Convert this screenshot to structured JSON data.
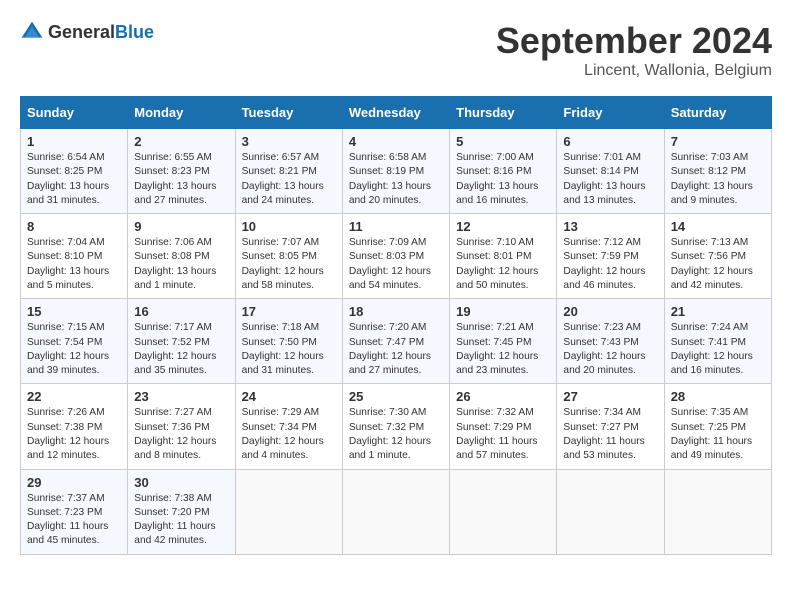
{
  "logo": {
    "general": "General",
    "blue": "Blue"
  },
  "title": "September 2024",
  "location": "Lincent, Wallonia, Belgium",
  "days_of_week": [
    "Sunday",
    "Monday",
    "Tuesday",
    "Wednesday",
    "Thursday",
    "Friday",
    "Saturday"
  ],
  "weeks": [
    [
      {
        "day": "1",
        "sunrise": "6:54 AM",
        "sunset": "8:25 PM",
        "daylight": "13 hours and 31 minutes."
      },
      {
        "day": "2",
        "sunrise": "6:55 AM",
        "sunset": "8:23 PM",
        "daylight": "13 hours and 27 minutes."
      },
      {
        "day": "3",
        "sunrise": "6:57 AM",
        "sunset": "8:21 PM",
        "daylight": "13 hours and 24 minutes."
      },
      {
        "day": "4",
        "sunrise": "6:58 AM",
        "sunset": "8:19 PM",
        "daylight": "13 hours and 20 minutes."
      },
      {
        "day": "5",
        "sunrise": "7:00 AM",
        "sunset": "8:16 PM",
        "daylight": "13 hours and 16 minutes."
      },
      {
        "day": "6",
        "sunrise": "7:01 AM",
        "sunset": "8:14 PM",
        "daylight": "13 hours and 13 minutes."
      },
      {
        "day": "7",
        "sunrise": "7:03 AM",
        "sunset": "8:12 PM",
        "daylight": "13 hours and 9 minutes."
      }
    ],
    [
      {
        "day": "8",
        "sunrise": "7:04 AM",
        "sunset": "8:10 PM",
        "daylight": "13 hours and 5 minutes."
      },
      {
        "day": "9",
        "sunrise": "7:06 AM",
        "sunset": "8:08 PM",
        "daylight": "13 hours and 1 minute."
      },
      {
        "day": "10",
        "sunrise": "7:07 AM",
        "sunset": "8:05 PM",
        "daylight": "12 hours and 58 minutes."
      },
      {
        "day": "11",
        "sunrise": "7:09 AM",
        "sunset": "8:03 PM",
        "daylight": "12 hours and 54 minutes."
      },
      {
        "day": "12",
        "sunrise": "7:10 AM",
        "sunset": "8:01 PM",
        "daylight": "12 hours and 50 minutes."
      },
      {
        "day": "13",
        "sunrise": "7:12 AM",
        "sunset": "7:59 PM",
        "daylight": "12 hours and 46 minutes."
      },
      {
        "day": "14",
        "sunrise": "7:13 AM",
        "sunset": "7:56 PM",
        "daylight": "12 hours and 42 minutes."
      }
    ],
    [
      {
        "day": "15",
        "sunrise": "7:15 AM",
        "sunset": "7:54 PM",
        "daylight": "12 hours and 39 minutes."
      },
      {
        "day": "16",
        "sunrise": "7:17 AM",
        "sunset": "7:52 PM",
        "daylight": "12 hours and 35 minutes."
      },
      {
        "day": "17",
        "sunrise": "7:18 AM",
        "sunset": "7:50 PM",
        "daylight": "12 hours and 31 minutes."
      },
      {
        "day": "18",
        "sunrise": "7:20 AM",
        "sunset": "7:47 PM",
        "daylight": "12 hours and 27 minutes."
      },
      {
        "day": "19",
        "sunrise": "7:21 AM",
        "sunset": "7:45 PM",
        "daylight": "12 hours and 23 minutes."
      },
      {
        "day": "20",
        "sunrise": "7:23 AM",
        "sunset": "7:43 PM",
        "daylight": "12 hours and 20 minutes."
      },
      {
        "day": "21",
        "sunrise": "7:24 AM",
        "sunset": "7:41 PM",
        "daylight": "12 hours and 16 minutes."
      }
    ],
    [
      {
        "day": "22",
        "sunrise": "7:26 AM",
        "sunset": "7:38 PM",
        "daylight": "12 hours and 12 minutes."
      },
      {
        "day": "23",
        "sunrise": "7:27 AM",
        "sunset": "7:36 PM",
        "daylight": "12 hours and 8 minutes."
      },
      {
        "day": "24",
        "sunrise": "7:29 AM",
        "sunset": "7:34 PM",
        "daylight": "12 hours and 4 minutes."
      },
      {
        "day": "25",
        "sunrise": "7:30 AM",
        "sunset": "7:32 PM",
        "daylight": "12 hours and 1 minute."
      },
      {
        "day": "26",
        "sunrise": "7:32 AM",
        "sunset": "7:29 PM",
        "daylight": "11 hours and 57 minutes."
      },
      {
        "day": "27",
        "sunrise": "7:34 AM",
        "sunset": "7:27 PM",
        "daylight": "11 hours and 53 minutes."
      },
      {
        "day": "28",
        "sunrise": "7:35 AM",
        "sunset": "7:25 PM",
        "daylight": "11 hours and 49 minutes."
      }
    ],
    [
      {
        "day": "29",
        "sunrise": "7:37 AM",
        "sunset": "7:23 PM",
        "daylight": "11 hours and 45 minutes."
      },
      {
        "day": "30",
        "sunrise": "7:38 AM",
        "sunset": "7:20 PM",
        "daylight": "11 hours and 42 minutes."
      },
      null,
      null,
      null,
      null,
      null
    ]
  ]
}
